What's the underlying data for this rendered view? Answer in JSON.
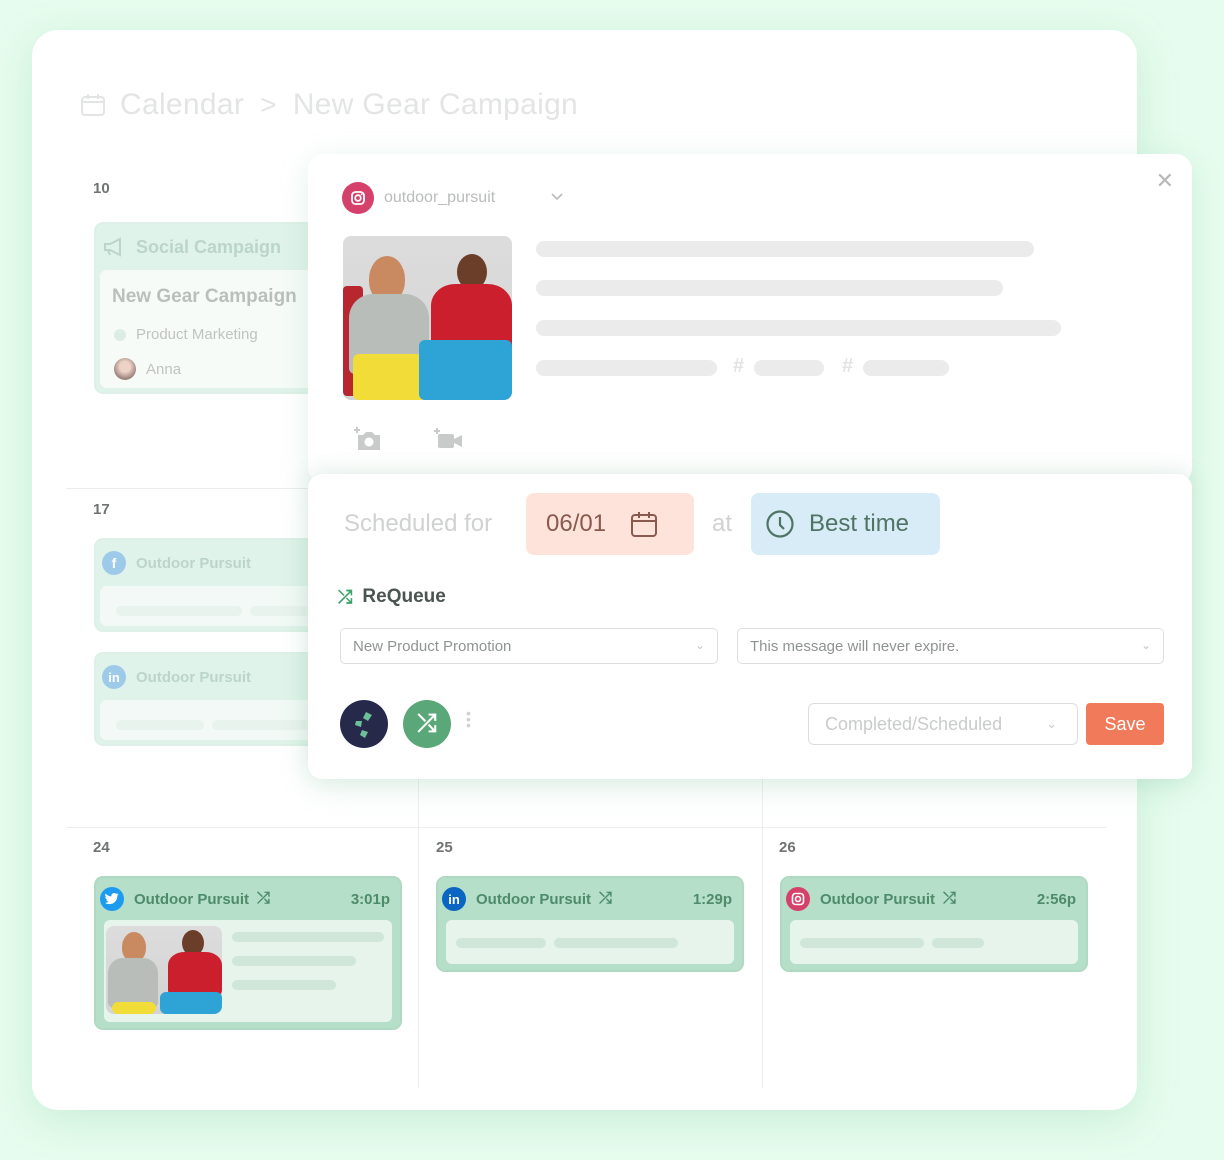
{
  "breadcrumb": {
    "icon": "calendar-icon",
    "root": "Calendar",
    "separator": ">",
    "current": "New Gear Campaign"
  },
  "calendar": {
    "weeks": [
      {
        "day": "10",
        "campaign_card": {
          "type_icon": "megaphone-icon",
          "type_label": "Social Campaign",
          "title": "New Gear Campaign",
          "tag": "Product Marketing",
          "owner": "Anna"
        }
      },
      {
        "day": "17",
        "posts": [
          {
            "network": "facebook",
            "icon": "facebook-icon",
            "glyph": "f",
            "account": "Outdoor Pursuit",
            "color": "#4b9ad8"
          },
          {
            "network": "linkedin",
            "icon": "linkedin-icon",
            "glyph": "in",
            "account": "Outdoor Pursuit",
            "color": "#4b9ad8"
          }
        ]
      }
    ],
    "bottom_row": [
      {
        "day": "24",
        "network": "twitter",
        "icon": "twitter-icon",
        "account": "Outdoor Pursuit",
        "requeue_icon": "shuffle-icon",
        "time": "3:01p",
        "color": "#1d9bf0",
        "has_image": true
      },
      {
        "day": "25",
        "network": "linkedin",
        "icon": "linkedin-icon",
        "account": "Outdoor Pursuit",
        "requeue_icon": "shuffle-icon",
        "time": "1:29p",
        "color": "#0a66c2",
        "has_image": false
      },
      {
        "day": "26",
        "network": "instagram",
        "icon": "instagram-icon",
        "account": "Outdoor Pursuit",
        "requeue_icon": "shuffle-icon",
        "time": "2:56p",
        "color": "#d6416b",
        "has_image": false
      }
    ]
  },
  "composer": {
    "account": {
      "network_icon": "instagram-icon",
      "handle": "outdoor_pursuit",
      "dropdown_icon": "chevron-down-icon"
    },
    "close_icon": "close-icon",
    "hashtag_symbol": "#",
    "media_buttons": [
      {
        "icon": "add-photo-icon"
      },
      {
        "icon": "add-video-icon"
      }
    ],
    "schedule": {
      "label": "Scheduled for",
      "date": "06/01",
      "date_icon": "calendar-icon",
      "at_label": "at",
      "time_icon": "clock-icon",
      "time": "Best time"
    },
    "requeue": {
      "icon": "shuffle-icon",
      "label": "ReQueue",
      "category": "New Product Promotion",
      "expiration": "This message will never expire."
    },
    "footer": {
      "brand_button_icon": "leaf-icon",
      "requeue_button_icon": "shuffle-icon",
      "more_icon": "more-vertical-icon",
      "status": "Completed/Scheduled",
      "save_label": "Save"
    }
  },
  "colors": {
    "background": "#e6fcee",
    "card_green": "#b5dfc8",
    "date_pill": "#fde3da",
    "time_pill": "#d7ecf6",
    "save": "#f07a5a",
    "brand_dark": "#27294a",
    "requeue_green": "#5aa879",
    "instagram": "#d6416b"
  }
}
